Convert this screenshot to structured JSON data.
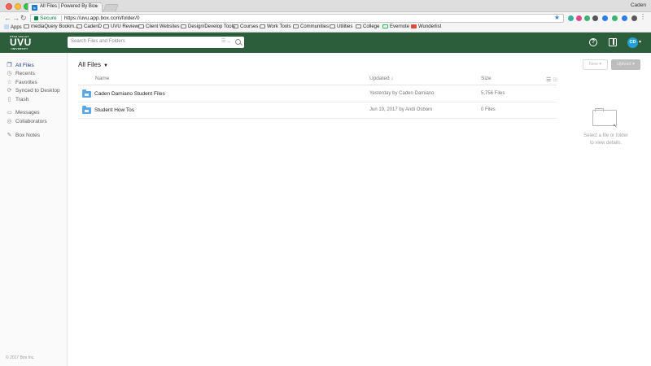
{
  "browser": {
    "tab_title": "All Files | Powered By Box",
    "tab_favicon": "box",
    "user_name": "Caden",
    "secure_label": "Secure",
    "url": "https://uvu.app.box.com/folder/0",
    "bookmarks": [
      {
        "label": "Apps"
      },
      {
        "label": "mediaQuery Bookm..."
      },
      {
        "label": "CadenD"
      },
      {
        "label": "UVU Review"
      },
      {
        "label": "Client Websites"
      },
      {
        "label": "Design/Develop Tools"
      },
      {
        "label": "Courses"
      },
      {
        "label": "Work Tools"
      },
      {
        "label": "Communities"
      },
      {
        "label": "Utilities"
      },
      {
        "label": "College"
      },
      {
        "label": "Evernote"
      },
      {
        "label": "Wunderlist"
      }
    ],
    "extension_colors": [
      "#3ab0a0",
      "#d94b8a",
      "#3cb371",
      "#555555",
      "#2b7de9",
      "#5a5a5a"
    ]
  },
  "header": {
    "logo_small": "UTAH VALLEY",
    "logo_big": "UVU",
    "logo_sub": "UNIVERSITY",
    "search_placeholder": "Search Files and Folders",
    "search_options": "☰ ⌄",
    "avatar_initials": "CD",
    "brand_color": "#2d5e3b"
  },
  "sidebar": {
    "items": [
      {
        "label": "All Files",
        "icon": "files-icon"
      },
      {
        "label": "Recents",
        "icon": "clock-icon"
      },
      {
        "label": "Favorites",
        "icon": "star-icon"
      },
      {
        "label": "Synced to Desktop",
        "icon": "sync-icon"
      },
      {
        "label": "Trash",
        "icon": "trash-icon"
      },
      {
        "label": "Messages",
        "icon": "message-icon"
      },
      {
        "label": "Collaborators",
        "icon": "people-icon"
      },
      {
        "label": "Box Notes",
        "icon": "notes-icon"
      }
    ],
    "copyright": "© 2017 Box Inc."
  },
  "main": {
    "breadcrumb": "All Files",
    "new_button": "New",
    "upload_button": "Upload",
    "columns": {
      "name": "Name",
      "updated": "Updated",
      "size": "Size"
    },
    "rows": [
      {
        "name": "Caden Damiano Student Files",
        "updated": "Yesterday by Caden Damiano",
        "size": "5,756 Files"
      },
      {
        "name": "Student How Tos",
        "updated": "Jun 19, 2017 by Andi Osborn",
        "size": "0 Files"
      }
    ]
  },
  "details": {
    "line1": "Select a file or folder",
    "line2": "to view details."
  }
}
